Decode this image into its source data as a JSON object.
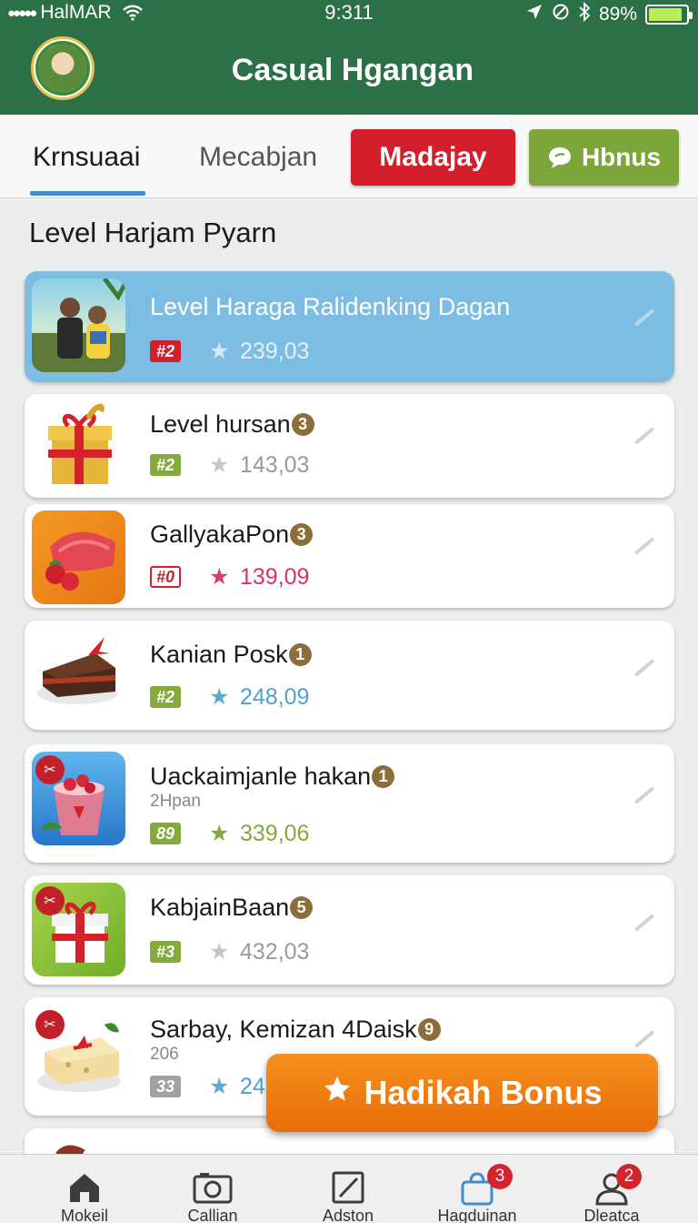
{
  "status_bar": {
    "carrier": "HalMAR",
    "time": "9:311",
    "battery": "89%",
    "battery_level": 0.89
  },
  "header": {
    "title": "Casual Hgangan"
  },
  "tabs": {
    "items": [
      {
        "label": "Krnsuaai",
        "active": true
      },
      {
        "label": "Mecabjan",
        "active": false
      }
    ],
    "red_button": "Madajay",
    "green_button": "Hbnus"
  },
  "section_title": "Level Harjam Pyarn",
  "levels": [
    {
      "title": "Level Haraga Ralidenking Dagan",
      "badge": "#2",
      "score": "239,03",
      "selected": true
    },
    {
      "title": "Level hursan",
      "num": "3",
      "badge": "#2",
      "score": "143,03"
    },
    {
      "title": "GallyakaPon",
      "num": "3",
      "badge": "#0",
      "score": "139,09"
    },
    {
      "title": "Kanian Posk",
      "num": "1",
      "badge": "#2",
      "score": "248,09"
    },
    {
      "title": "Uackaimjanle hakan",
      "num": "1",
      "sub": "2Hpan",
      "badge": "89",
      "score": "339,06"
    },
    {
      "title": "KabjainBaan",
      "num": "5",
      "badge": "#3",
      "score": "432,03"
    },
    {
      "title": "Sarbay, Kemizan 4Daisk",
      "num": "9",
      "sub": "206",
      "badge": "33",
      "score": "24"
    }
  ],
  "fab": {
    "label": "Hadikah Bonus"
  },
  "bottom_nav": [
    {
      "label": "Mokeil",
      "icon": "home-icon"
    },
    {
      "label": "Callian",
      "icon": "camera-icon"
    },
    {
      "label": "Adston",
      "icon": "edit-icon"
    },
    {
      "label": "Hagduinan",
      "icon": "bag-icon",
      "badge": "3"
    },
    {
      "label": "Dleatca",
      "icon": "profile-icon",
      "badge": "2"
    }
  ],
  "colors": {
    "header_green": "#2b7046",
    "red": "#d31f2b",
    "green": "#7ca63a",
    "selected_blue": "#7ebde3",
    "orange": "#ef7f12"
  }
}
